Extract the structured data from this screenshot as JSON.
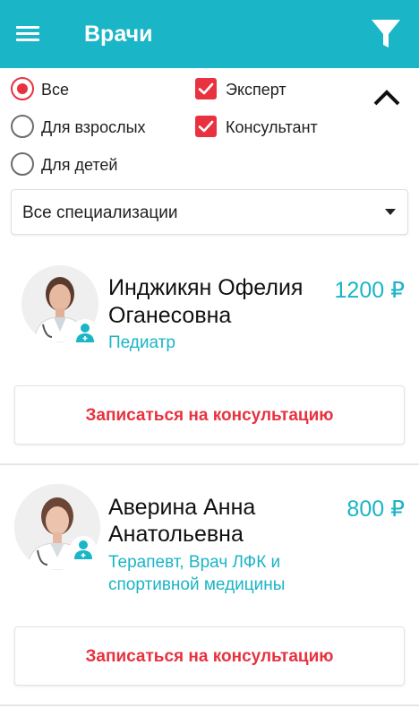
{
  "colors": {
    "accent": "#1ab5c6",
    "danger": "#e8323f"
  },
  "appbar": {
    "title": "Врачи",
    "menu_icon": "menu-icon",
    "filter_icon": "filter-icon"
  },
  "filters": {
    "age": [
      {
        "label": "Все",
        "selected": true
      },
      {
        "label": "Для взрослых",
        "selected": false
      },
      {
        "label": "Для детей",
        "selected": false
      }
    ],
    "roles": [
      {
        "label": "Эксперт",
        "checked": true
      },
      {
        "label": "Консультант",
        "checked": true
      }
    ],
    "collapse_icon": "chevron-up-icon"
  },
  "specialization_select": {
    "value": "Все специализации"
  },
  "doctors": [
    {
      "name_line1": "Инджикян Офелия",
      "name_line2": "Оганесовна",
      "price": "1200 ₽",
      "specialty_line1": "Педиатр",
      "specialty_line2": "",
      "button_label": "Записаться на консультацию"
    },
    {
      "name_line1": "Аверина Анна",
      "name_line2": "Анатольевна",
      "price": "800 ₽",
      "specialty_line1": "Терапевт, Врач ЛФК и",
      "specialty_line2": "спортивной медицины",
      "button_label": "Записаться на консультацию"
    }
  ]
}
